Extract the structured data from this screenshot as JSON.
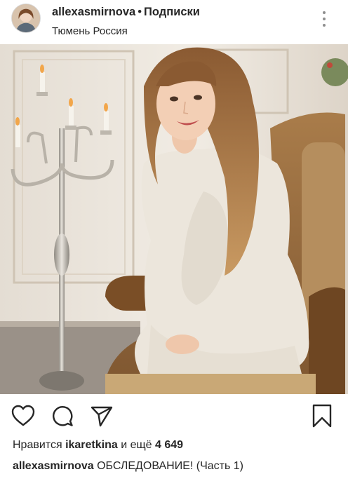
{
  "post": {
    "username": "allexasmirnova",
    "separator": "•",
    "follow_label": "Подписки",
    "location": "Тюмень Россия",
    "photo_alt": "allexasmirnova"
  },
  "likes": {
    "prefix": "Нравится",
    "user": "ikaretkina",
    "middle": "и ещё",
    "count": "4 649"
  },
  "caption": {
    "username": "allexasmirnova",
    "text": "ОБСЛЕДОВАНИЕ! (Часть 1)"
  },
  "icons": {
    "more": "more-vertical-icon",
    "like": "heart-icon",
    "comment": "comment-icon",
    "share": "send-icon",
    "save": "bookmark-icon"
  }
}
